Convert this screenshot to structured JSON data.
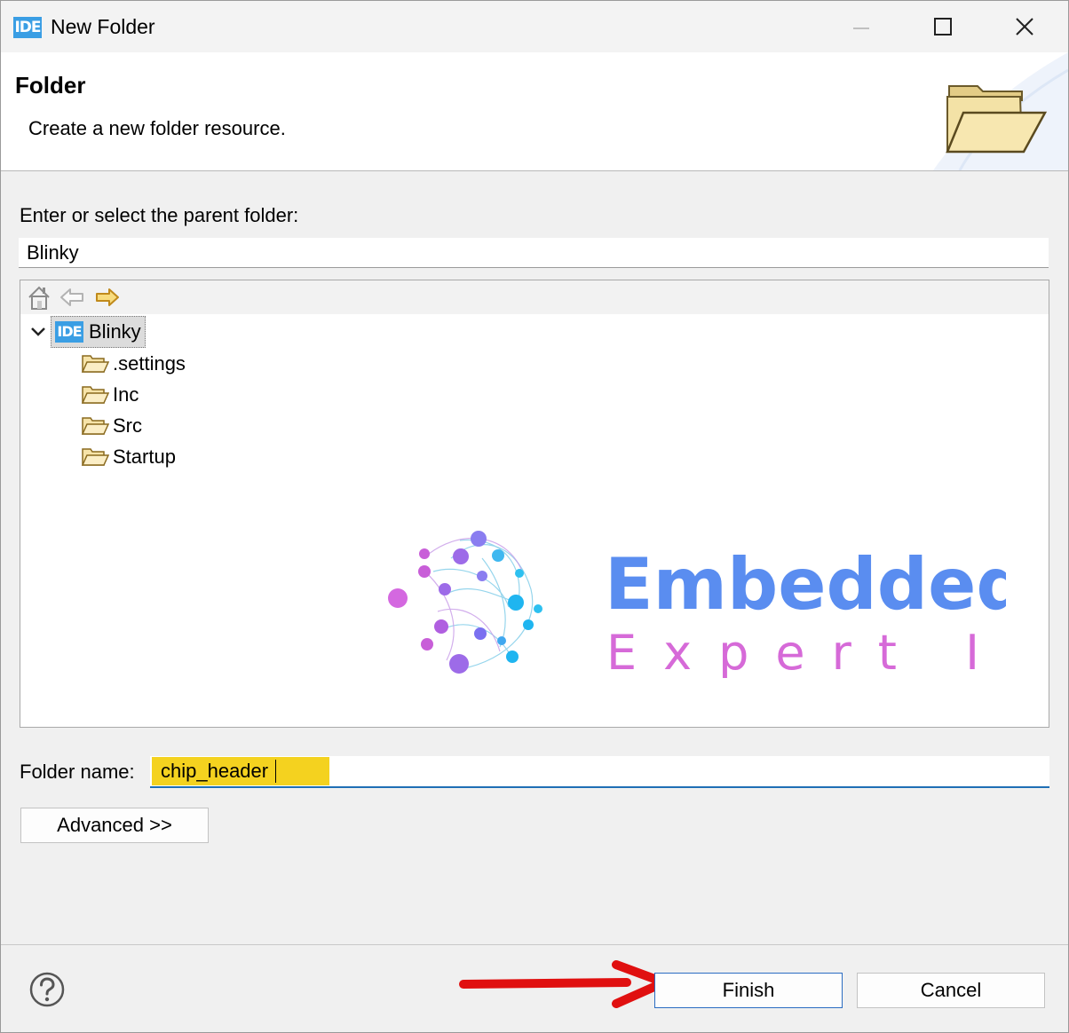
{
  "window": {
    "app_icon_text": "IDE",
    "title": "New Folder"
  },
  "banner": {
    "title": "Folder",
    "description": "Create a new folder resource."
  },
  "parent_folder": {
    "label": "Enter or select the parent folder:",
    "value": "Blinky"
  },
  "tree": {
    "project": {
      "icon_text": "IDE",
      "label": "Blinky",
      "expanded": true,
      "selected": true
    },
    "folders": [
      {
        "label": ".settings"
      },
      {
        "label": "Inc"
      },
      {
        "label": "Src"
      },
      {
        "label": "Startup"
      }
    ],
    "toolbar_icons": [
      "home-icon",
      "back-arrow-icon",
      "forward-arrow-icon"
    ]
  },
  "watermark": {
    "line1": "Embedded",
    "line2": "Expert IO"
  },
  "folder_name": {
    "label": "Folder name:",
    "value": "chip_header"
  },
  "buttons": {
    "advanced": "Advanced >>",
    "finish": "Finish",
    "cancel": "Cancel"
  },
  "colors": {
    "accent": "#3a9ee4",
    "highlight": "#f4d21f",
    "arrow": "#e01010",
    "logo_blue": "#5a8df0",
    "logo_pink": "#d66ad8"
  }
}
